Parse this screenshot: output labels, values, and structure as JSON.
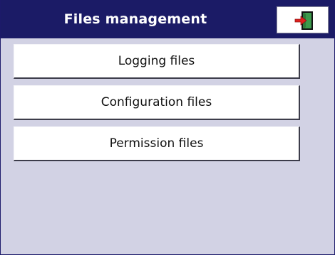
{
  "header": {
    "title": "Files management",
    "exit_icon": "exit-door-icon"
  },
  "menu": {
    "items": [
      {
        "label": "Logging files"
      },
      {
        "label": "Configuration files"
      },
      {
        "label": "Permission files"
      }
    ]
  },
  "colors": {
    "header_bg": "#1b1b66",
    "screen_bg": "#d2d2e4",
    "button_bg": "#ffffff",
    "exit_arrow": "#e0201e",
    "exit_door": "#2f7a3a"
  }
}
